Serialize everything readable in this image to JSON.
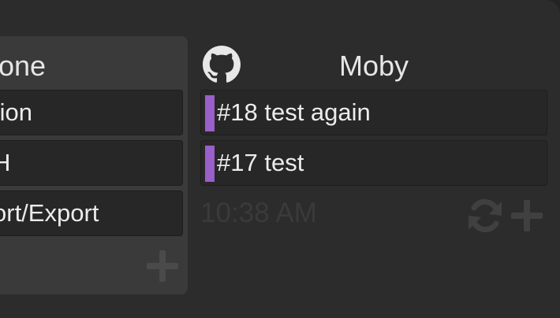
{
  "left_column": {
    "title": "one",
    "items": [
      "tion",
      "H",
      "ort/Export"
    ]
  },
  "right_column": {
    "title": "Moby",
    "items": [
      "#18 test again",
      "#17 test"
    ],
    "accent": "#9a5fc9",
    "time": "10:38 AM"
  },
  "icons": {
    "github": "github-icon",
    "refresh": "refresh-icon",
    "add": "plus-icon"
  }
}
